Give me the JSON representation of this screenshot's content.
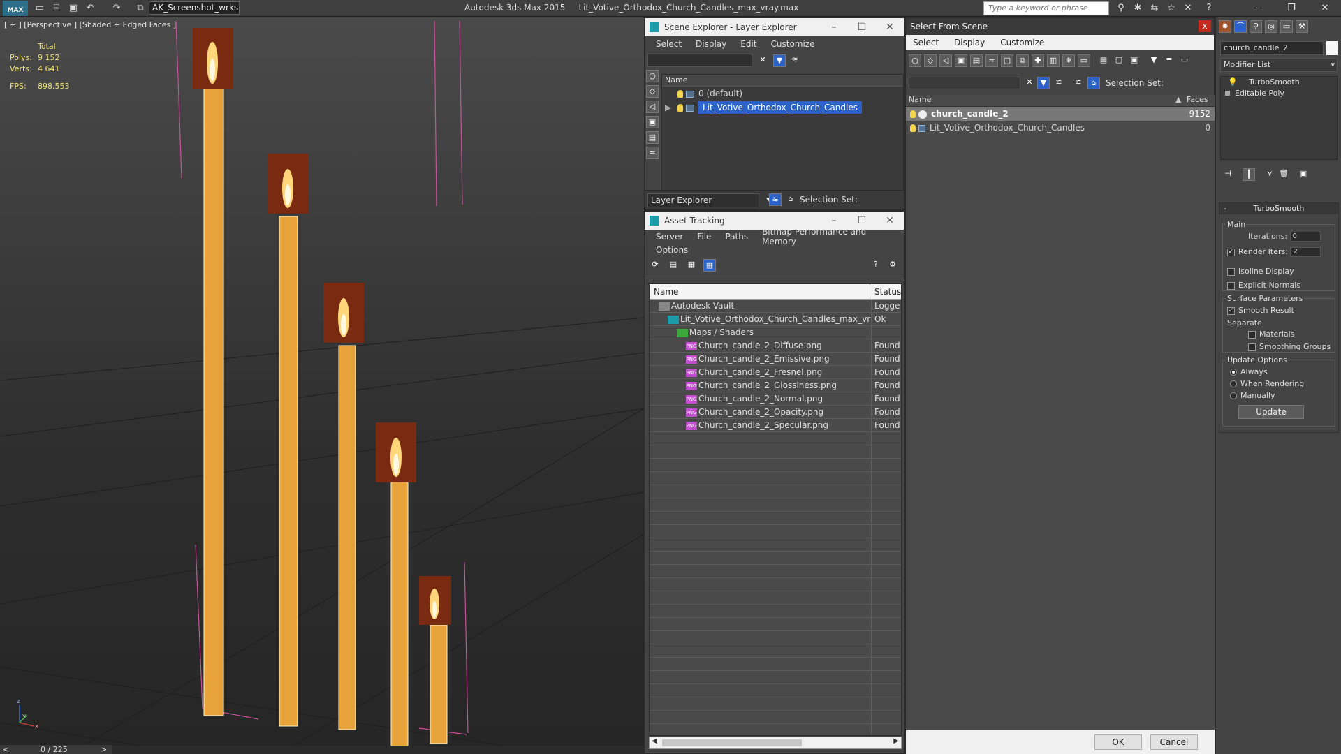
{
  "titlebar": {
    "logo": "MAX",
    "workspace": "AK_Screenshot_wrksp",
    "app_name": "Autodesk 3ds Max  2015",
    "file_name": "Lit_Votive_Orthodox_Church_Candles_max_vray.max",
    "search_placeholder": "Type a keyword or phrase"
  },
  "viewport": {
    "label": "[ + ] [Perspective ] [Shaded + Edged Faces ]",
    "stats": {
      "total_label": "Total",
      "polys_label": "Polys:",
      "polys_value": "9 152",
      "verts_label": "Verts:",
      "verts_value": "4 641",
      "fps_label": "FPS:",
      "fps_value": "898,553"
    },
    "axis_z": "z",
    "axis_y": "y",
    "axis_x": "x"
  },
  "timeline": {
    "frame": "0 / 225",
    "prev": "<",
    "next": ">"
  },
  "scene_explorer": {
    "title": "Scene Explorer - Layer Explorer",
    "menu": [
      "Select",
      "Display",
      "Edit",
      "Customize"
    ],
    "column_name": "Name",
    "rows": [
      {
        "label": "0 (default)"
      },
      {
        "label": "Lit_Votive_Orthodox_Church_Candles"
      }
    ],
    "footer_combo": "Layer Explorer",
    "footer_selset": "Selection Set:"
  },
  "asset_tracking": {
    "title": "Asset Tracking",
    "menu_row1": [
      "Server",
      "File",
      "Paths",
      "Bitmap Performance and Memory"
    ],
    "menu_row2": [
      "Options"
    ],
    "col_name": "Name",
    "col_status": "Status",
    "rows": [
      {
        "name": "Autodesk Vault",
        "status": "Logged",
        "indent": 1,
        "icon": "vault"
      },
      {
        "name": "Lit_Votive_Orthodox_Church_Candles_max_vray....",
        "status": "Ok",
        "indent": 2,
        "icon": "max"
      },
      {
        "name": "Maps / Shaders",
        "status": "",
        "indent": 3,
        "icon": "maps"
      },
      {
        "name": "Church_candle_2_Diffuse.png",
        "status": "Found",
        "indent": 4,
        "icon": "png"
      },
      {
        "name": "Church_candle_2_Emissive.png",
        "status": "Found",
        "indent": 4,
        "icon": "png"
      },
      {
        "name": "Church_candle_2_Fresnel.png",
        "status": "Found",
        "indent": 4,
        "icon": "png"
      },
      {
        "name": "Church_candle_2_Glossiness.png",
        "status": "Found",
        "indent": 4,
        "icon": "png"
      },
      {
        "name": "Church_candle_2_Normal.png",
        "status": "Found",
        "indent": 4,
        "icon": "png"
      },
      {
        "name": "Church_candle_2_Opacity.png",
        "status": "Found",
        "indent": 4,
        "icon": "png"
      },
      {
        "name": "Church_candle_2_Specular.png",
        "status": "Found",
        "indent": 4,
        "icon": "png"
      }
    ],
    "png_badge": "PNG"
  },
  "select_from_scene": {
    "title": "Select From Scene",
    "close": "x",
    "menu": [
      "Select",
      "Display",
      "Customize"
    ],
    "selset_label": "Selection Set:",
    "col_name": "Name",
    "col_faces": "Faces",
    "rows": [
      {
        "name": "church_candle_2",
        "faces": "9152"
      },
      {
        "name": "Lit_Votive_Orthodox_Church_Candles",
        "faces": "0"
      }
    ],
    "ok": "OK",
    "cancel": "Cancel"
  },
  "command_panel": {
    "object_name": "church_candle_2",
    "modifier_list": "Modifier List",
    "stack": [
      "TurboSmooth",
      "Editable Poly"
    ],
    "rollout_title": "TurboSmooth",
    "rollout_collapse": "-",
    "main_label": "Main",
    "iterations_label": "Iterations:",
    "iterations_value": "0",
    "render_iters_label": "Render Iters:",
    "render_iters_value": "2",
    "isoline_label": "Isoline Display",
    "explicit_normals_label": "Explicit Normals",
    "surface_params_label": "Surface Parameters",
    "smooth_result_label": "Smooth Result",
    "separate_label": "Separate",
    "materials_label": "Materials",
    "smoothing_groups_label": "Smoothing Groups",
    "update_options_label": "Update Options",
    "always_label": "Always",
    "when_rendering_label": "When Rendering",
    "manually_label": "Manually",
    "update_button": "Update"
  }
}
